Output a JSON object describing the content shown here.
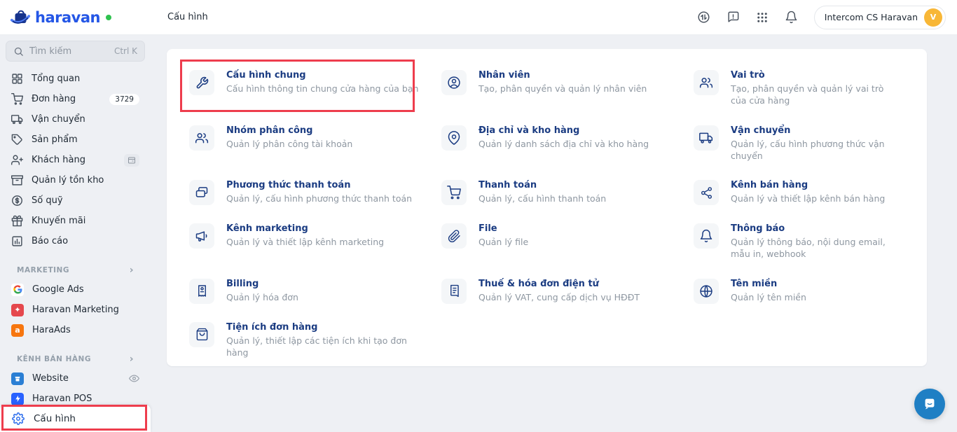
{
  "topbar": {
    "brand": "haravan",
    "page_title": "Cấu hình",
    "account_name": "Intercom CS Haravan",
    "avatar_initial": "V"
  },
  "search": {
    "placeholder": "Tìm kiếm",
    "shortcut": "Ctrl K"
  },
  "sidebar": {
    "items": [
      {
        "label": "Tổng quan"
      },
      {
        "label": "Đơn hàng",
        "badge": "3729"
      },
      {
        "label": "Vận chuyển"
      },
      {
        "label": "Sản phẩm"
      },
      {
        "label": "Khách hàng"
      },
      {
        "label": "Quản lý tồn kho"
      },
      {
        "label": "Số quỹ"
      },
      {
        "label": "Khuyến mãi"
      },
      {
        "label": "Báo cáo"
      }
    ],
    "marketing_header": "MARKETING",
    "marketing_items": [
      {
        "label": "Google Ads",
        "tile_letter": "G"
      },
      {
        "label": "Haravan Marketing",
        "tile_glyph": "✦"
      },
      {
        "label": "HaraAds",
        "tile_letter": "a"
      }
    ],
    "channels_header": "KÊNH BÁN HÀNG",
    "channel_items": [
      {
        "label": "Website"
      },
      {
        "label": "Haravan POS"
      }
    ],
    "settings_label": "Cấu hình"
  },
  "cards": [
    {
      "title": "Cấu hình chung",
      "desc": "Cấu hình thông tin chung cửa hàng của bạn"
    },
    {
      "title": "Nhân viên",
      "desc": "Tạo, phân quyền và quản lý nhân viên"
    },
    {
      "title": "Vai trò",
      "desc": "Tạo, phân quyền và quản lý vai trò của cửa hàng"
    },
    {
      "title": "Nhóm phân công",
      "desc": "Quản lý phân công tài khoản"
    },
    {
      "title": "Địa chỉ và kho hàng",
      "desc": "Quản lý danh sách địa chỉ và kho hàng"
    },
    {
      "title": "Vận chuyển",
      "desc": "Quản lý, cấu hình phương thức vận chuyển"
    },
    {
      "title": "Phương thức thanh toán",
      "desc": "Quản lý, cấu hình phương thức thanh toán"
    },
    {
      "title": "Thanh toán",
      "desc": "Quản lý, cấu hình thanh toán"
    },
    {
      "title": "Kênh bán hàng",
      "desc": "Quản lý và thiết lập kênh bán hàng"
    },
    {
      "title": "Kênh marketing",
      "desc": "Quản lý và thiết lập kênh marketing"
    },
    {
      "title": "File",
      "desc": "Quản lý file"
    },
    {
      "title": "Thông báo",
      "desc": "Quản lý thông báo, nội dung email, mẫu in, webhook"
    },
    {
      "title": "Billing",
      "desc": "Quản lý hóa đơn"
    },
    {
      "title": "Thuế & hóa đơn điện tử",
      "desc": "Quản lý VAT, cung cấp dịch vụ HĐĐT"
    },
    {
      "title": "Tên miền",
      "desc": "Quản lý tên miền"
    },
    {
      "title": "Tiện ích đơn hàng",
      "desc": "Quản lý, thiết lập các tiện ích khi tạo đơn hàng"
    }
  ],
  "colors": {
    "brand_blue": "#2456e6",
    "card_navy": "#1b3c82",
    "annotation_red": "#ee3d4d",
    "avatar_orange": "#f8b737",
    "intercom_blue": "#1f7fc4"
  }
}
